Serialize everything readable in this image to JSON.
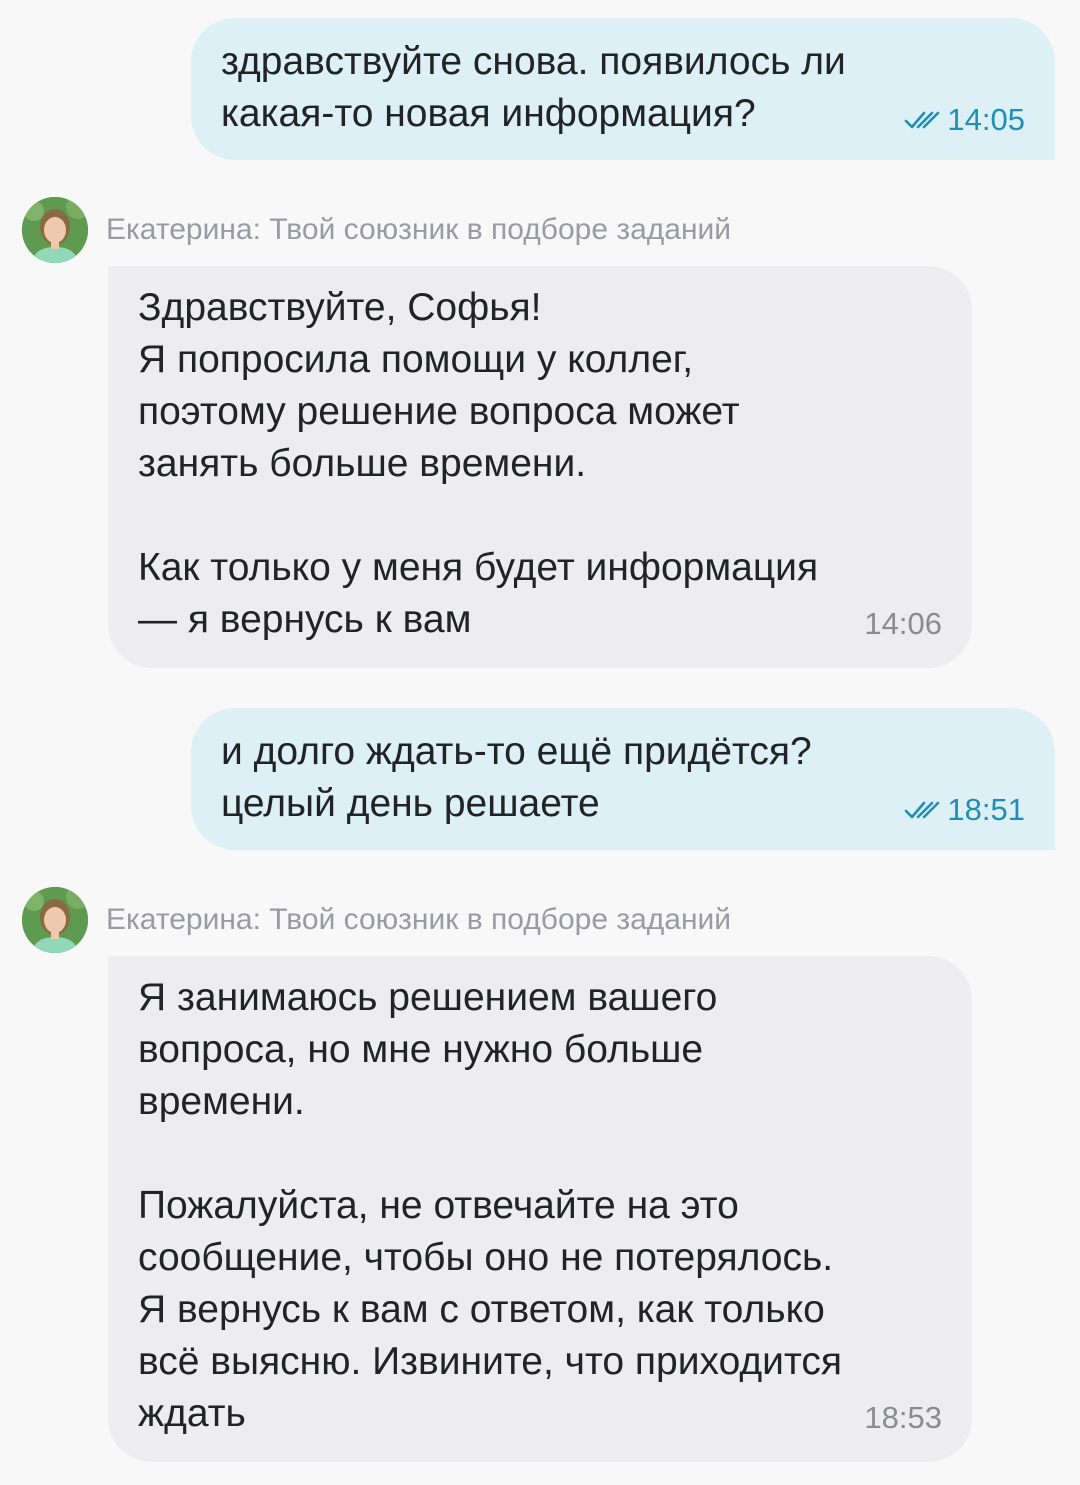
{
  "messages": [
    {
      "direction": "out",
      "text": "здравствуйте снова. появилось ли\nкакая-то новая информация?",
      "time": "14:05",
      "status_icon": "double-check-icon"
    },
    {
      "direction": "in",
      "sender": "Екатерина: Твой союзник в подборе заданий",
      "text": "Здравствуйте, Софья!\nЯ попросила помощи у коллег,\nпоэтому решение вопроса может\nзанять больше времени.\n\nКак только у меня будет информация\n— я вернусь к вам",
      "time": "14:06"
    },
    {
      "direction": "out",
      "text": "и долго ждать-то ещё придётся?\nцелый день решаете",
      "time": "18:51",
      "status_icon": "double-check-icon"
    },
    {
      "direction": "in",
      "sender": "Екатерина: Твой союзник в подборе заданий",
      "text": "Я занимаюсь решением вашего\nвопроса, но мне нужно больше\nвремени.\n\nПожалуйста, не отвечайте на это\nсообщение, чтобы оно не потерялось.\nЯ вернусь к вам с ответом, как только\nвсё выясню. Извините, что приходится\nждать",
      "time": "18:53"
    }
  ],
  "colors": {
    "background": "#f8f8f9",
    "outgoing_bubble": "#dcf0f6",
    "incoming_bubble": "#ededf0",
    "read_status": "#1f8fb6",
    "timestamp_incoming": "#8a8b90",
    "sender_name": "#9a9ba0"
  }
}
